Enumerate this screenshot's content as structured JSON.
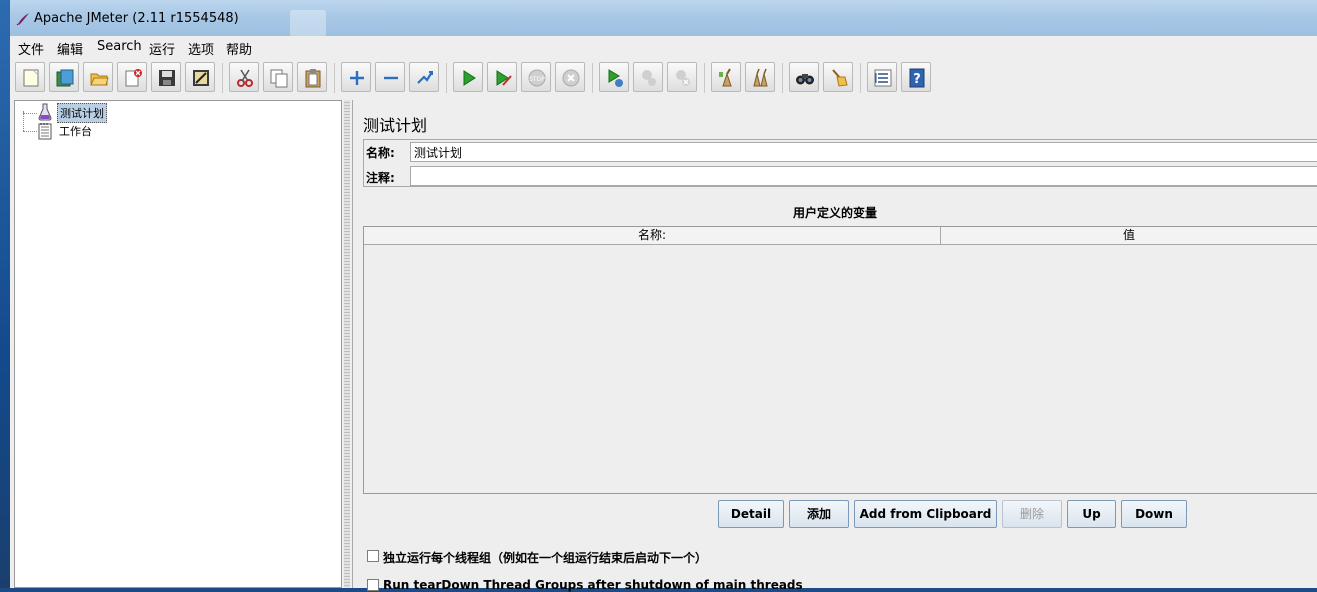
{
  "window": {
    "title": "Apache JMeter (2.11 r1554548)"
  },
  "menubar": {
    "items": [
      "文件",
      "编辑",
      "Search",
      "运行",
      "选项",
      "帮助"
    ]
  },
  "toolbar": {
    "buttons": [
      "new-icon",
      "templates-icon",
      "open-icon",
      "close-icon",
      "save-icon",
      "save-as-icon",
      "cut-icon",
      "copy-icon",
      "paste-icon",
      "expand-icon",
      "collapse-icon",
      "toggle-icon",
      "start-icon",
      "start-no-pauses-icon",
      "stop-icon",
      "shutdown-icon",
      "remote-start-icon",
      "remote-stop-icon",
      "remote-exit-icon",
      "clear-icon",
      "clear-all-icon",
      "search-icon",
      "reset-search-icon",
      "function-helper-icon",
      "help-icon"
    ]
  },
  "tree": {
    "nodes": [
      {
        "label": "测试计划",
        "icon": "flask-icon",
        "selected": true
      },
      {
        "label": "工作台",
        "icon": "notepad-icon",
        "selected": false
      }
    ]
  },
  "main": {
    "title": "测试计划",
    "name_label": "名称:",
    "name_value": "测试计划",
    "comment_label": "注释:",
    "comment_value": "",
    "vars_title": "用户定义的变量",
    "table": {
      "columns": [
        "名称:",
        "值"
      ],
      "rows": []
    },
    "buttons": {
      "detail": "Detail",
      "add": "添加",
      "add_clipboard": "Add from Clipboard",
      "delete": "删除",
      "up": "Up",
      "down": "Down"
    },
    "checkboxes": [
      {
        "label": "独立运行每个线程组（例如在一个组运行结束后启动下一个）",
        "checked": false
      },
      {
        "label": "Run tearDown Thread Groups after shutdown of main threads",
        "checked": false
      }
    ]
  }
}
